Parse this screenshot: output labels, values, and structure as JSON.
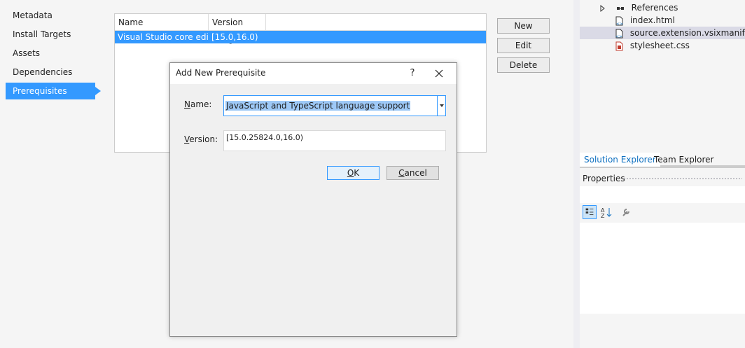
{
  "nav": {
    "items": [
      {
        "label": "Metadata"
      },
      {
        "label": "Install Targets"
      },
      {
        "label": "Assets"
      },
      {
        "label": "Dependencies"
      },
      {
        "label": "Prerequisites",
        "active": true
      }
    ]
  },
  "list": {
    "columns": [
      "Name",
      "Version Range"
    ],
    "rows": [
      {
        "name": "Visual Studio core editor",
        "version": "[15.0,16.0)"
      }
    ]
  },
  "buttons": {
    "new": "New",
    "edit": "Edit",
    "delete": "Delete"
  },
  "solution_explorer": {
    "items": [
      {
        "label": "References",
        "icon": "references-icon"
      },
      {
        "label": "index.html",
        "icon": "html-file-icon"
      },
      {
        "label": "source.extension.vsixmanifest",
        "icon": "manifest-file-icon",
        "selected": true
      },
      {
        "label": "stylesheet.css",
        "icon": "css-file-icon"
      }
    ]
  },
  "tabs": {
    "solution": "Solution Explorer",
    "team": "Team Explorer"
  },
  "properties": {
    "title": "Properties"
  },
  "dialog": {
    "title": "Add New Prerequisite",
    "help": "?",
    "name_label_first": "N",
    "name_label_rest": "ame:",
    "name_value": "JavaScript and TypeScript language support",
    "version_label_first": "V",
    "version_label_rest": "ersion:",
    "version_value": "[15.0.25824.0,16.0)",
    "ok_first": "O",
    "ok_rest": "K",
    "cancel_first": "C",
    "cancel_rest": "ancel"
  },
  "colors": {
    "accent": "#3399ff",
    "selection_text_bg": "#9ec9f7",
    "tab_active_text": "#0e70c0"
  }
}
